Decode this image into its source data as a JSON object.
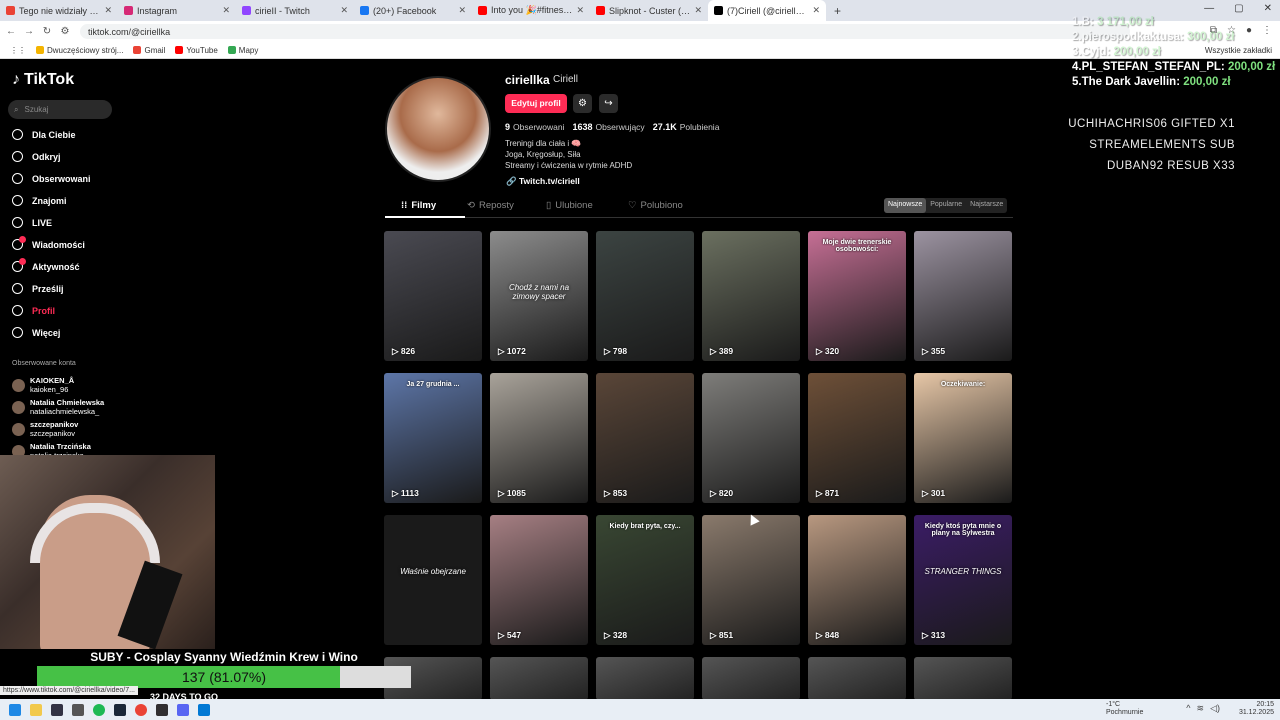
{
  "browser": {
    "tabs": [
      {
        "title": "Tego nie widziały kamery. Prawd",
        "color": "#ea4335"
      },
      {
        "title": "Instagram",
        "color": "#d62976"
      },
      {
        "title": "cirieII - Twitch",
        "color": "#9146ff"
      },
      {
        "title": "(20+) Facebook",
        "color": "#1877f2"
      },
      {
        "title": "Into you 🎉#fitnessdance - YouT",
        "color": "#ff0000"
      },
      {
        "title": "Slipknot - Custer (Audio)",
        "color": "#ff0000"
      },
      {
        "title": "(7)Ciriell (@ciriellka) | TikTok",
        "color": "#000000"
      }
    ],
    "new_tab": "+",
    "url": "tiktok.com/@ciriellka",
    "bookmarks": [
      "Dwuczęściowy strój...",
      "Gmail",
      "YouTube",
      "Mapy"
    ],
    "all_bookmarks": "Wszystkie zakładki"
  },
  "sidebar": {
    "logo": "TikTok",
    "search_placeholder": "Szukaj",
    "nav": [
      {
        "label": "Dla Ciebie",
        "icon": "home-icon"
      },
      {
        "label": "Odkryj",
        "icon": "compass-icon"
      },
      {
        "label": "Obserwowani",
        "icon": "following-icon"
      },
      {
        "label": "Znajomi",
        "icon": "friends-icon"
      },
      {
        "label": "LIVE",
        "icon": "live-icon"
      },
      {
        "label": "Wiadomości",
        "icon": "messages-icon"
      },
      {
        "label": "Aktywność",
        "icon": "activity-icon"
      },
      {
        "label": "Prześlij",
        "icon": "upload-icon"
      },
      {
        "label": "Profil",
        "icon": "profile-icon"
      },
      {
        "label": "Więcej",
        "icon": "more-icon"
      }
    ],
    "followed_title": "Obserwowane konta",
    "followed": [
      {
        "name": "KAIOKEN_Å",
        "handle": "kaioken_96"
      },
      {
        "name": "Natalia Chmielewska",
        "handle": "nataliachmielewska_"
      },
      {
        "name": "szczepanikov",
        "handle": "szczepanikov"
      },
      {
        "name": "Natalia Trzcińska",
        "handle": "natalia.trzcinska"
      }
    ]
  },
  "profile": {
    "username": "ciriellka",
    "display_name": "Ciriell",
    "edit_button": "Edytuj profil",
    "following_count": "9",
    "following_label": "Obserwowani",
    "followers_count": "1638",
    "followers_label": "Obserwujący",
    "likes_count": "27.1K",
    "likes_label": "Polubienia",
    "bio_lines": [
      "Treningi dla ciała i 🧠",
      "Joga, Kręgosłup, Siła",
      "Streamy i ćwiczenia w rytmie ADHD"
    ],
    "link": "Twitch.tv/ciriell"
  },
  "content_tabs": [
    "Filmy",
    "Reposty",
    "Ulubione",
    "Polubiono"
  ],
  "sort": [
    "Najnowsze",
    "Popularne",
    "Najstarsze"
  ],
  "videos": [
    {
      "views": "826",
      "caption": "",
      "top": "",
      "bg": "#4a4a52"
    },
    {
      "views": "1072",
      "caption": "Chodź z nami na zimowy spacer",
      "top": "",
      "bg": "#8c8c8c"
    },
    {
      "views": "798",
      "caption": "",
      "top": "",
      "bg": "#3c4442"
    },
    {
      "views": "389",
      "caption": "",
      "top": "",
      "bg": "#6b7060"
    },
    {
      "views": "320",
      "caption": "",
      "top": "Moje dwie trenerskie osobowości:",
      "bg": "#c66f95"
    },
    {
      "views": "355",
      "caption": "",
      "top": "",
      "bg": "#9c93a1"
    },
    {
      "views": "1113",
      "caption": "",
      "top": "Ja 27 grudnia ...",
      "bg": "#5d76a8"
    },
    {
      "views": "1085",
      "caption": "",
      "top": "",
      "bg": "#a9a39a"
    },
    {
      "views": "853",
      "caption": "",
      "top": "",
      "bg": "#5a4638"
    },
    {
      "views": "820",
      "caption": "",
      "top": "",
      "bg": "#7e7d7a"
    },
    {
      "views": "871",
      "caption": "",
      "top": "",
      "bg": "#6e5038"
    },
    {
      "views": "301",
      "caption": "",
      "top": "Oczekiwanie:",
      "bg": "#e7c7a7"
    },
    {
      "views": "",
      "caption": "Właśnie obejrzane",
      "top": "",
      "bg": "#1a1a1a"
    },
    {
      "views": "547",
      "caption": "",
      "top": "",
      "bg": "#a67f83"
    },
    {
      "views": "328",
      "caption": "",
      "top": "Kiedy brat pyta, czy...",
      "bg": "#394733"
    },
    {
      "views": "851",
      "caption": "",
      "top": "",
      "bg": "#8a7a6c"
    },
    {
      "views": "848",
      "caption": "",
      "top": "",
      "bg": "#b89880"
    },
    {
      "views": "313",
      "caption": "STRANGER THINGS",
      "top": "Kiedy ktoś pyta mnie o plany na Sylwestra",
      "bg": "#3b1c66"
    }
  ],
  "stream_overlay": {
    "top_donors": [
      {
        "rank": "1.B:",
        "amount": "3 171,00 zł",
        "faded": true
      },
      {
        "rank": "2.pierospodkaktusa:",
        "amount": "300,00 zł",
        "faded": true
      },
      {
        "rank": "3.Cyjd:",
        "amount": "200,00 zł",
        "faded": true
      },
      {
        "rank": "4.PL_STEFAN_STEFAN_PL:",
        "amount": "200,00 zł",
        "faded": false
      },
      {
        "rank": "5.The Dark Javellin:",
        "amount": "200,00 zł",
        "faded": false
      }
    ],
    "events": [
      "UCHIHACHRIS06  GIFTED X1",
      "STREAMELEMENTS  SUB",
      "DUBAN92  RESUB X33"
    ],
    "sub_goal_title": "SUBY - Cosplay Syanny Wiedźmin Krew i Wino",
    "sub_goal_text": "137 (81.07%)",
    "sub_goal_progress": 0.8107,
    "sub_goal_remaining": "32 DAYS TO GO"
  },
  "status_url": "https://www.tiktok.com/@ciriellka/video/7...",
  "taskbar": {
    "weather_temp": "-1°C",
    "weather_desc": "Pochmurnie",
    "time": "20:15",
    "date": "31.12.2025"
  }
}
